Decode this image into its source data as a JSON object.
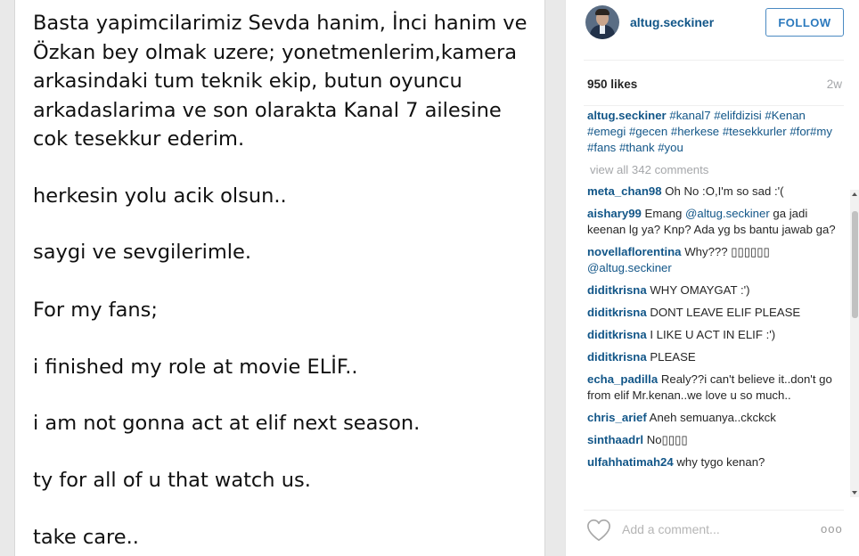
{
  "photo": {
    "lines": [
      "Basta yapimcilarimiz Sevda hanim, İnci hanim ve",
      "Özkan bey olmak uzere; yonetmenlerim,kamera",
      "arkasindaki tum teknik ekip, butun oyuncu",
      "arkadaslarima ve son olarakta Kanal 7 ailesine",
      "cok tesekkur ederim.",
      "herkesin yolu acik olsun..",
      "saygi ve sevgilerimle.",
      "For my fans;",
      "i finished my role at movie ELİF..",
      "i am not gonna act at elif next season.",
      "ty for all of u that watch us.",
      "take care.."
    ]
  },
  "post": {
    "username": "altug.seckiner",
    "follow_label": "FOLLOW",
    "likes": "950 likes",
    "age": "2w",
    "caption": {
      "user": "altug.seckiner",
      "hashtags": [
        "#kanal7",
        "#elifdizisi",
        "#Kenan",
        "#emegi",
        "#gecen",
        "#herkese",
        "#tesekkurler",
        "#for#my",
        "#fans",
        "#thank",
        "#you"
      ]
    },
    "view_all": "view all 342 comments",
    "comments": [
      {
        "user": "meta_chan98",
        "text": "Oh No :O,I'm so sad :'("
      },
      {
        "user": "aishary99",
        "text": "Emang ",
        "mention": "@altug.seckiner",
        "text2": " ga jadi keenan lg ya? Knp? Ada yg bs bantu jawab ga?"
      },
      {
        "user": "novellaflorentina",
        "text": "Why??? ▯▯▯▯▯▯ ",
        "mention": "@altug.seckiner",
        "text2": ""
      },
      {
        "user": "diditkrisna",
        "text": "WHY OMAYGAT :')"
      },
      {
        "user": "diditkrisna",
        "text": "DONT LEAVE ELIF PLEASE"
      },
      {
        "user": "diditkrisna",
        "text": "I LIKE U ACT IN ELIF :')"
      },
      {
        "user": "diditkrisna",
        "text": "PLEASE"
      },
      {
        "user": "echa_padilla",
        "text": "Realy??i can't believe it..don't go from elif Mr.kenan..we love u so much.."
      },
      {
        "user": "chris_arief",
        "text": "Aneh semuanya..ckckck"
      },
      {
        "user": "sinthaadrl",
        "text": "No▯▯▯▯"
      },
      {
        "user": "ulfahhatimah24",
        "text": "why tygo kenan?"
      }
    ],
    "comment_placeholder": "Add a comment...",
    "more_label": "ooo"
  },
  "colors": {
    "link": "#125688",
    "follow": "#2b79bd",
    "muted": "#a5a7aa",
    "background": "#e9e9e9"
  },
  "icons": [
    "heart-icon",
    "more-options-icon",
    "scroll-up-arrow-icon",
    "scroll-down-arrow-icon"
  ]
}
